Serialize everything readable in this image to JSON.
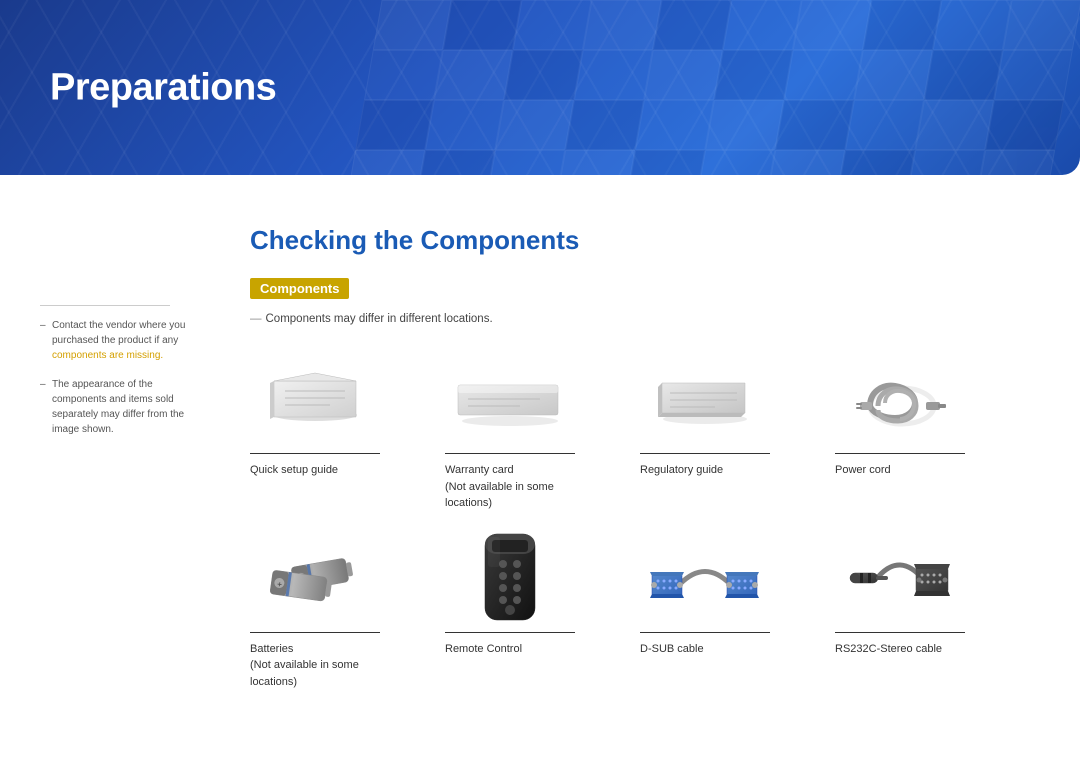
{
  "header": {
    "title": "Preparations"
  },
  "sidebar": {
    "notes": [
      {
        "text_before": "Contact the vendor where you purchased the product if any components are missing.",
        "highlight": "components are missing."
      },
      {
        "text_before": "The appearance of the components and items sold separately may differ from the image shown.",
        "highlight": ""
      }
    ]
  },
  "main": {
    "section_title": "Checking the Components",
    "badge_label": "Components",
    "components_note": "Components may differ in different locations.",
    "components": [
      {
        "label": "Quick setup guide",
        "sublabel": "",
        "icon": "setup-guide"
      },
      {
        "label": "Warranty card",
        "sublabel": "(Not available in some locations)",
        "icon": "warranty-card"
      },
      {
        "label": "Regulatory guide",
        "sublabel": "",
        "icon": "regulatory-guide"
      },
      {
        "label": "Power cord",
        "sublabel": "",
        "icon": "power-cord"
      },
      {
        "label": "Batteries",
        "sublabel": "(Not available in some locations)",
        "icon": "batteries"
      },
      {
        "label": "Remote Control",
        "sublabel": "",
        "icon": "remote-control"
      },
      {
        "label": "D-SUB cable",
        "sublabel": "",
        "icon": "dsub-cable"
      },
      {
        "label": "RS232C-Stereo cable",
        "sublabel": "",
        "icon": "rs232c-cable"
      }
    ]
  }
}
